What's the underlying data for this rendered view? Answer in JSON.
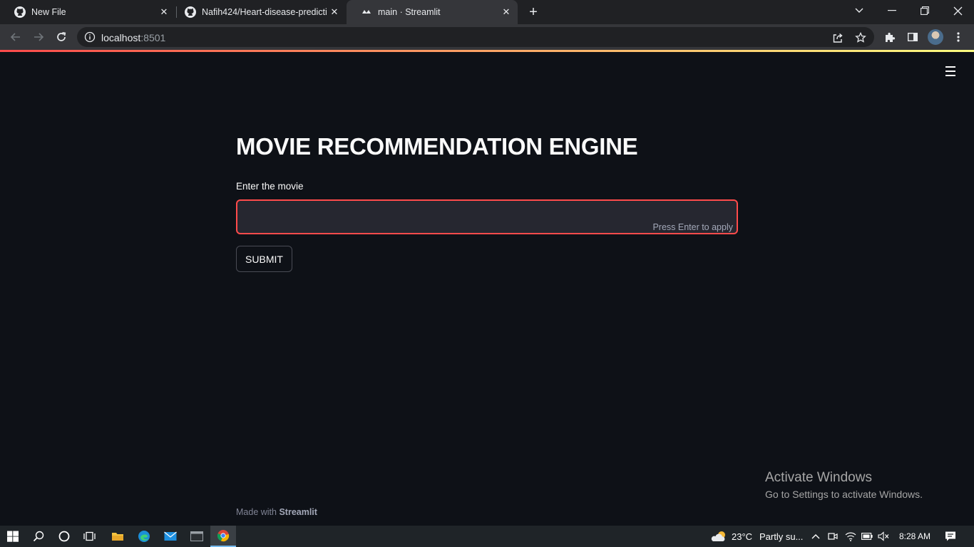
{
  "browser": {
    "tabs": [
      {
        "title": "New File",
        "icon": "github-icon",
        "active": false
      },
      {
        "title": "Nafih424/Heart-disease-predictio",
        "icon": "github-icon",
        "active": false
      },
      {
        "title": "main · Streamlit",
        "icon": "streamlit-icon",
        "active": true
      }
    ],
    "address": {
      "host": "localhost",
      "port": ":8501"
    }
  },
  "app": {
    "title": "MOVIE RECOMMENDATION ENGINE",
    "input": {
      "label": "Enter the movie",
      "value": "",
      "hint": "Press Enter to apply"
    },
    "submit_label": "SUBMIT",
    "footer": {
      "prefix": "Made with ",
      "brand": "Streamlit"
    },
    "accent_color": "#ff4b4b"
  },
  "watermark": {
    "line1": "Activate Windows",
    "line2": "Go to Settings to activate Windows."
  },
  "taskbar": {
    "weather": {
      "temp": "23°C",
      "desc": "Partly su..."
    },
    "time": "8:28 AM"
  }
}
